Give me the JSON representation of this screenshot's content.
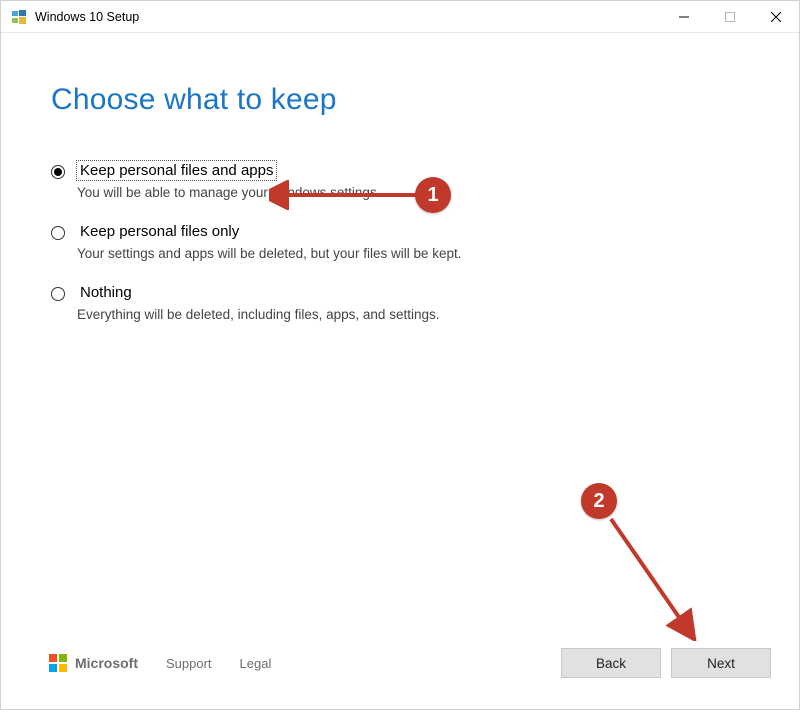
{
  "window": {
    "title": "Windows 10 Setup"
  },
  "page": {
    "heading": "Choose what to keep"
  },
  "options": [
    {
      "label": "Keep personal files and apps",
      "description": "You will be able to manage your Windows settings.",
      "selected": true
    },
    {
      "label": "Keep personal files only",
      "description": "Your settings and apps will be deleted, but your files will be kept.",
      "selected": false
    },
    {
      "label": "Nothing",
      "description": "Everything will be deleted, including files, apps, and settings.",
      "selected": false
    }
  ],
  "footer": {
    "brand": "Microsoft",
    "links": {
      "support": "Support",
      "legal": "Legal"
    },
    "back": "Back",
    "next": "Next"
  },
  "annotations": {
    "callout1": "1",
    "callout2": "2"
  }
}
